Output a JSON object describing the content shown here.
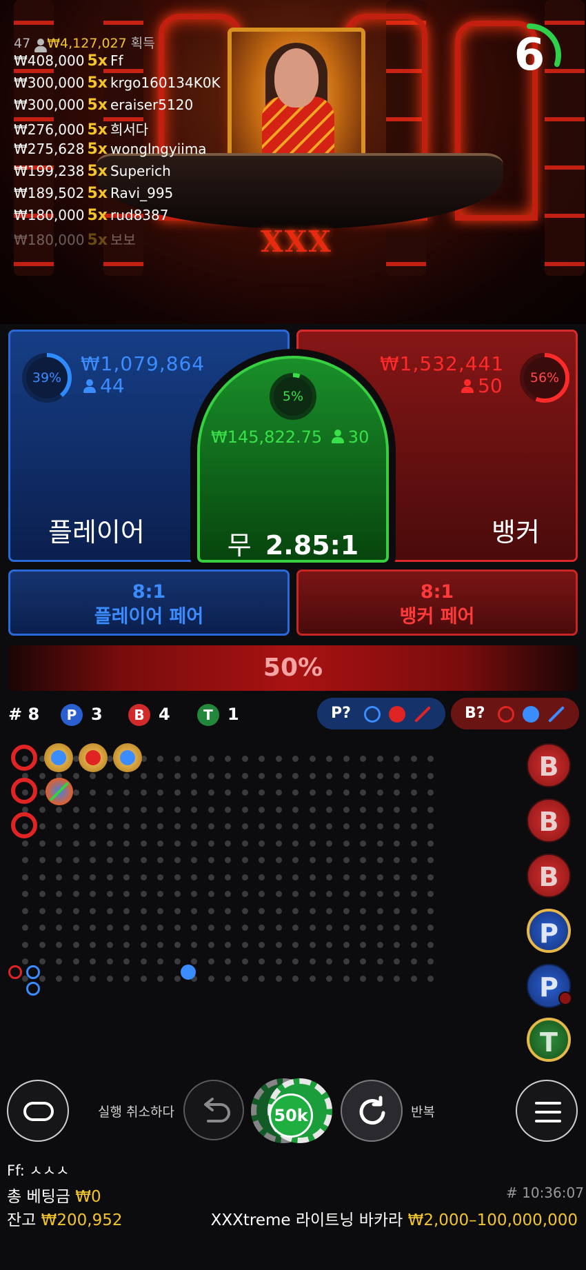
{
  "video": {
    "winners_count": "47",
    "winners_total": "₩4,127,027",
    "winners_label": "획득",
    "winners": [
      {
        "amount": "₩408,000",
        "mult": "5x",
        "name": "Ff"
      },
      {
        "amount": "₩300,000",
        "mult": "5x",
        "name": "krgo160134K0K"
      },
      {
        "amount": "₩300,000",
        "mult": "5x",
        "name": "eraiser5120"
      },
      {
        "amount": "₩276,000",
        "mult": "5x",
        "name": "희서다"
      },
      {
        "amount": "₩275,628",
        "mult": "5x",
        "name": "wonglngyiima"
      },
      {
        "amount": "₩199,238",
        "mult": "5x",
        "name": "Superich"
      },
      {
        "amount": "₩189,502",
        "mult": "5x",
        "name": "Ravi_995"
      },
      {
        "amount": "₩180,000",
        "mult": "5x",
        "name": "rud8387"
      },
      {
        "amount": "₩180,000",
        "mult": "5x",
        "name": "보보"
      }
    ],
    "table_logo": "XXX",
    "timer_value": "6",
    "timer_fraction": 0.3
  },
  "bets": {
    "player": {
      "label": "플레이어",
      "amount": "₩1,079,864",
      "players": "44",
      "percent": "39%",
      "fraction": 0.39
    },
    "banker": {
      "label": "뱅커",
      "amount": "₩1,532,441",
      "players": "50",
      "percent": "56%",
      "fraction": 0.56
    },
    "tie": {
      "label_main": "무",
      "odds": "2.85:1",
      "amount": "₩145,822.75",
      "players": "30",
      "percent": "5%",
      "fraction": 0.05
    },
    "player_pair": {
      "odds": "8:1",
      "label": "플레이어 페어"
    },
    "banker_pair": {
      "odds": "8:1",
      "label": "뱅커 페어"
    },
    "progress": "50%"
  },
  "roadmap": {
    "round_label": "#",
    "round": "8",
    "player_letter": "P",
    "player_count": "3",
    "banker_letter": "B",
    "banker_count": "4",
    "tie_letter": "T",
    "tie_count": "1",
    "predict_player": "P?",
    "predict_banker": "B?",
    "big_badges": [
      "B",
      "B",
      "B",
      "P",
      "P",
      "T"
    ]
  },
  "controls": {
    "undo_label": "실행 취소하다",
    "repeat_label": "반복",
    "chip_value": "50k"
  },
  "footer": {
    "user_line": "Ff: ㅅㅅㅅ",
    "total_bet_label": "총 베팅금",
    "total_bet_value": "₩0",
    "balance_label": "잔고",
    "balance_value": "₩200,952",
    "game_name": "XXXtreme 라이트닝 바카라",
    "limits": "₩2,000–100,000,000",
    "time": "# 10:36:07"
  },
  "colors": {
    "player": "#2a6ad8",
    "banker": "#d82a2a",
    "tie": "#36d040",
    "gold": "#f2c52b"
  }
}
